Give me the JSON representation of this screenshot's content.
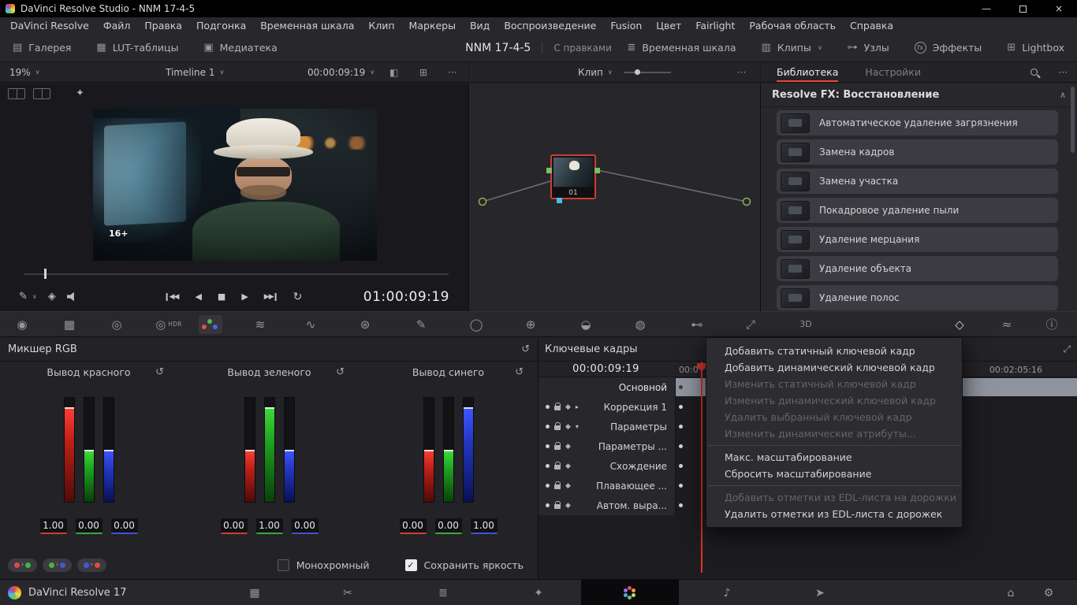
{
  "glyphs": {
    "gallery": "▤",
    "lut": "▦",
    "media_pool": "▣",
    "timeline_view": "≣",
    "clips": "▥",
    "nodes_view": "⊶",
    "fx": "fx",
    "lightbox": "⊞",
    "chevron_down": "∨",
    "overflow": "···",
    "wipe": "◧",
    "split": "⊞",
    "wand": "✦",
    "picker": "✎",
    "layers": "◈",
    "skip_back": "◀◀",
    "reverse": "◀",
    "stop": "■",
    "play": "▶",
    "skip_fwd": "▶▶",
    "loop": "↻",
    "camera_raw": "◉",
    "color_match": "▦",
    "color_wheels": "◎",
    "hdr": "◎",
    "hdr_label": "HDR",
    "motion_effects": "≋",
    "curves": "∿",
    "color_warper": "⊛",
    "qualifier": "✎",
    "power_window": "◯",
    "tracker": "⊕",
    "magic_mask": "◒",
    "blur": "◍",
    "key": "⊷",
    "sizing": "⤢",
    "stereo_3d": "3D",
    "keyframes_toggle": "◇",
    "scopes": "≈",
    "info": "ⓘ",
    "reset": "↺",
    "collapse": "∧",
    "expand": "⤢",
    "diamond": "◆",
    "check": "✓",
    "swap_arrow": "›",
    "minimize": "—",
    "close": "×",
    "media_page": "▦",
    "cut_page": "✂",
    "edit_page": "≣",
    "fusion_page": "✦",
    "fairlight_page": "♪",
    "deliver_page": "➤",
    "home": "⌂",
    "gear": "⚙"
  },
  "titlebar": {
    "title": "DaVinci Resolve Studio - NNM 17-4-5"
  },
  "menubar": {
    "items": [
      "DaVinci Resolve",
      "Файл",
      "Правка",
      "Подгонка",
      "Временная шкала",
      "Клип",
      "Маркеры",
      "Вид",
      "Воспроизведение",
      "Fusion",
      "Цвет",
      "Fairlight",
      "Рабочая область",
      "Справка"
    ]
  },
  "topbar": {
    "gallery": "Галерея",
    "lut": "LUT-таблицы",
    "media_pool": "Медиатека",
    "project_title": "NNM 17-4-5",
    "project_status": "С правками",
    "timeline": "Временная шкала",
    "clips": "Клипы",
    "nodes": "Узлы",
    "effects": "Эффекты",
    "lightbox": "Lightbox"
  },
  "viewer": {
    "zoom": "19%",
    "timeline_name": "Timeline 1",
    "timecode": "00:00:09:19",
    "rating": "16+",
    "transport_timecode": "01:00:09:19"
  },
  "nodebar": {
    "mode": "Клип",
    "node_label": "01"
  },
  "library": {
    "tab_library": "Библиотека",
    "tab_settings": "Настройки",
    "section": "Resolve FX: Восстановление",
    "items": [
      "Автоматическое удаление загрязнения",
      "Замена кадров",
      "Замена участка",
      "Покадровое удаление пыли",
      "Удаление мерцания",
      "Удаление объекта",
      "Удаление полос"
    ]
  },
  "mixer": {
    "title": "Микшер RGB",
    "groups": [
      {
        "label": "Вывод красного",
        "values": [
          "1.00",
          "0.00",
          "0.00"
        ]
      },
      {
        "label": "Вывод зеленого",
        "values": [
          "0.00",
          "1.00",
          "0.00"
        ]
      },
      {
        "label": "Вывод синего",
        "values": [
          "0.00",
          "0.00",
          "1.00"
        ]
      }
    ],
    "monochrome_label": "Монохромный",
    "preserve_label": "Сохранить яркость"
  },
  "keyframes": {
    "title": "Ключевые кадры",
    "timecode": "00:00:09:19",
    "ruler_start": "00:0",
    "ruler_end": "00:02:05:16",
    "tracks": [
      {
        "label": "Основной"
      },
      {
        "label": "Коррекция 1",
        "chevron": "▸"
      },
      {
        "label": "Параметры",
        "chevron": "▾"
      },
      {
        "label": "Параметры ..."
      },
      {
        "label": "Схождение"
      },
      {
        "label": "Плавающее ..."
      },
      {
        "label": "Автом. выра..."
      }
    ]
  },
  "context_menu": {
    "items": [
      {
        "label": "Добавить статичный ключевой кадр",
        "enabled": true
      },
      {
        "label": "Добавить динамический ключевой кадр",
        "enabled": true
      },
      {
        "label": "Изменить статичный ключевой кадр",
        "enabled": false
      },
      {
        "label": "Изменить динамический ключевой кадр",
        "enabled": false
      },
      {
        "label": "Удалить выбранный ключевой кадр",
        "enabled": false
      },
      {
        "label": "Изменить динамические атрибуты...",
        "enabled": false
      },
      {
        "label": "Макс. масштабирование",
        "enabled": true
      },
      {
        "label": "Сбросить масштабирование",
        "enabled": true
      },
      {
        "label": "Добавить отметки из EDL-листа на дорожки",
        "enabled": false
      },
      {
        "label": "Удалить отметки из EDL-листа с дорожек",
        "enabled": true
      }
    ]
  },
  "statusbar": {
    "app": "DaVinci Resolve 17"
  }
}
